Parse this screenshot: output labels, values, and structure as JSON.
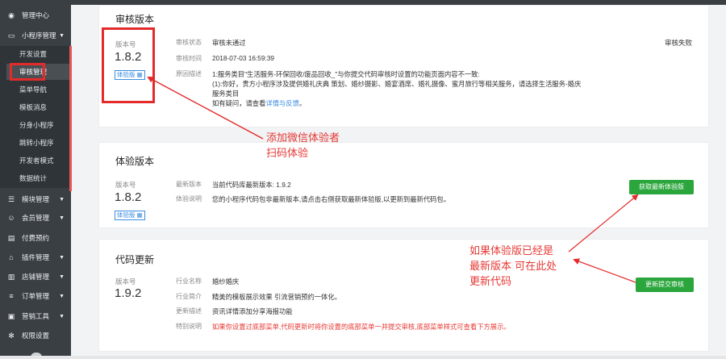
{
  "sidebar": {
    "items": [
      {
        "label": "管理中心",
        "icon": "dashboard-icon"
      },
      {
        "label": "小程序管理",
        "icon": "monitor-icon"
      },
      {
        "label": "模块管理",
        "icon": "list-icon"
      },
      {
        "label": "会员管理",
        "icon": "user-icon"
      },
      {
        "label": "付费预约",
        "icon": "card-icon"
      },
      {
        "label": "插件管理",
        "icon": "home-icon"
      },
      {
        "label": "店铺管理",
        "icon": "store-icon"
      },
      {
        "label": "订单管理",
        "icon": "order-icon"
      },
      {
        "label": "营销工具",
        "icon": "briefcase-icon"
      },
      {
        "label": "权限设置",
        "icon": "gear-icon"
      }
    ],
    "submenu": [
      "开发设置",
      "审核管理",
      "菜单导航",
      "模板消息",
      "分身小程序",
      "跳转小程序",
      "开发者模式",
      "数据统计"
    ]
  },
  "review": {
    "title": "审核版本",
    "version_label": "版本号",
    "version": "1.8.2",
    "badge": "体验版",
    "status_key": "审核状态",
    "status_value": "审核未通过",
    "time_key": "审核时间",
    "time_value": "2018-07-03 16:59:39",
    "reason_key": "原因描述",
    "reason_lines": [
      "1:服务类目\"生活服务-环保回收/废品回收_\"与你提交代码审核时设置的功能页面内容不一致:",
      "(1):你好，贵方小程序涉及提供婚礼庆典 策划、婚纱摄影、婚宴酒席、婚礼摄像、蜜月旅行等相关服务，请选择生活服务-婚庆",
      "服务类目"
    ],
    "help_prefix": "如有疑问，请查看",
    "help_link": "详情与反馈",
    "help_suffix": "。",
    "right_status": "审核失败"
  },
  "trial": {
    "title": "体验版本",
    "version_label": "版本号",
    "version": "1.8.2",
    "badge": "体验版",
    "latest_key": "最新版本",
    "latest_value": "当前代码库最新版本: 1.9.2",
    "desc_key": "体验说明",
    "desc_value": "您的小程序代码包非最新版本,请点击右侧获取最新体验版,以更新到最新代码包。",
    "button": "获取最新体验版"
  },
  "update": {
    "title": "代码更新",
    "version_label": "版本号",
    "version": "1.9.2",
    "industry_key": "行业名称",
    "industry_value": "婚纱婚庆",
    "intro_key": "行业简介",
    "intro_value": "精美的模板展示效果 引流营销预约一体化。",
    "update_key": "更新描述",
    "update_value": "资讯详情添加分享海报功能",
    "special_key": "特别说明",
    "special_value": "如果你设置过底部菜单,代码更新时将你设置的底部菜单一并提交审核,底部菜单样式可查看下方展示。",
    "button": "更新提交审核"
  },
  "annotations": {
    "note1": [
      "添加微信体验者",
      "扫码体验"
    ],
    "note2": [
      "如果体验版已经是",
      "最新版本  可在此处",
      "更新代码"
    ]
  },
  "colors": {
    "sidebar": "#3a3f44",
    "accent_green": "#2aa63c",
    "annotation_red": "#e32b2b",
    "link_blue": "#3a8de0"
  }
}
